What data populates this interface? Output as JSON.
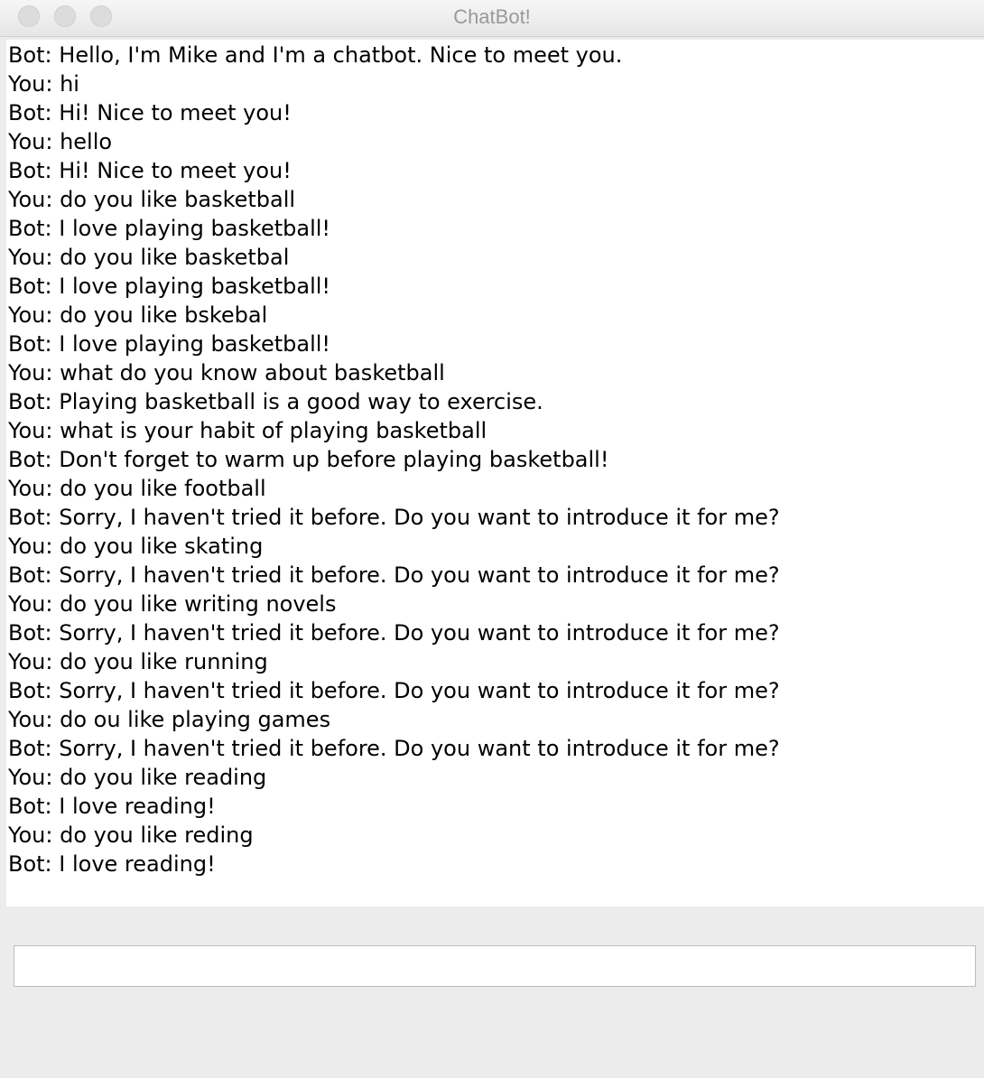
{
  "window": {
    "title": "ChatBot!"
  },
  "chat": {
    "lines": [
      "Bot: Hello, I'm Mike and I'm a chatbot. Nice to meet you.",
      "You: hi",
      "Bot: Hi! Nice to meet you!",
      "You: hello",
      "Bot: Hi! Nice to meet you!",
      "You: do you like basketball",
      "Bot: I love playing basketball!",
      "You: do you like basketbal",
      "Bot: I love playing basketball!",
      "You: do you like bskebal",
      "Bot: I love playing basketball!",
      "You: what do you know about basketball",
      "Bot: Playing basketball is a good way to exercise.",
      "You: what is your habit of playing basketball",
      "Bot: Don't forget to warm up before playing basketball!",
      "You: do you like football",
      "Bot: Sorry, I haven't tried it before. Do you want to introduce it for me?",
      "You: do you like skating",
      "Bot: Sorry, I haven't tried it before. Do you want to introduce it for me?",
      "You: do you like writing novels",
      "Bot: Sorry, I haven't tried it before. Do you want to introduce it for me?",
      "You: do you like running",
      "Bot: Sorry, I haven't tried it before. Do you want to introduce it for me?",
      "You: do ou like playing games",
      "Bot: Sorry, I haven't tried it before. Do you want to introduce it for me?",
      "You: do you like reading",
      "Bot: I love reading!",
      "You: do you like reding",
      "Bot: I love reading!"
    ]
  },
  "input": {
    "value": ""
  }
}
